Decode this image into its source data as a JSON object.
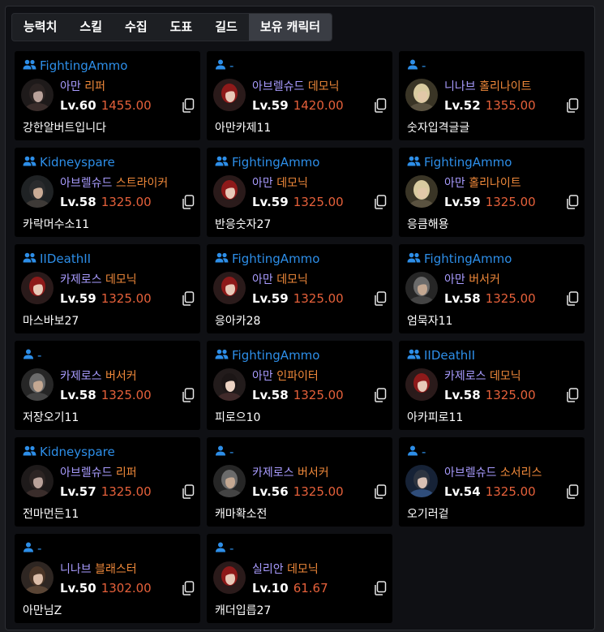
{
  "tabs": [
    "능력치",
    "스킬",
    "수집",
    "도표",
    "길드",
    "보유 캐릭터"
  ],
  "active_tab": 5,
  "colors": {
    "accent_user": "#2d8ee8",
    "server": "#a99cff",
    "class": "#f0893a",
    "item_level": "#e5603a"
  },
  "characters": [
    {
      "user_icon": "group-icon",
      "user": "FightingAmmo",
      "server": "아만",
      "cls": "리퍼",
      "level": "Lv.60",
      "ilvl": "1455.00",
      "name": "강한알버트입니다",
      "avatar": "dark-hooded"
    },
    {
      "user_icon": "person-icon",
      "user": "-",
      "server": "아브렐슈드",
      "cls": "데모닉",
      "level": "Lv.59",
      "ilvl": "1420.00",
      "name": "아만카제11",
      "avatar": "red-hair"
    },
    {
      "user_icon": "person-icon",
      "user": "-",
      "server": "니나브",
      "cls": "홀리나이트",
      "level": "Lv.52",
      "ilvl": "1355.00",
      "name": "숫자입격글글",
      "avatar": "blond"
    },
    {
      "user_icon": "group-icon",
      "user": "Kidneyspare",
      "server": "아브렐슈드",
      "cls": "스트라이커",
      "level": "Lv.58",
      "ilvl": "1325.00",
      "name": "카락머수소11",
      "avatar": "dark-male"
    },
    {
      "user_icon": "group-icon",
      "user": "FightingAmmo",
      "server": "아만",
      "cls": "데모닉",
      "level": "Lv.59",
      "ilvl": "1325.00",
      "name": "반응숫자27",
      "avatar": "red-hair"
    },
    {
      "user_icon": "group-icon",
      "user": "FightingAmmo",
      "server": "아만",
      "cls": "홀리나이트",
      "level": "Lv.59",
      "ilvl": "1325.00",
      "name": "응큼해용",
      "avatar": "blond"
    },
    {
      "user_icon": "group-icon",
      "user": "IIDeathII",
      "server": "카제로스",
      "cls": "데모닉",
      "level": "Lv.59",
      "ilvl": "1325.00",
      "name": "마스바보27",
      "avatar": "red-hair"
    },
    {
      "user_icon": "group-icon",
      "user": "FightingAmmo",
      "server": "아만",
      "cls": "데모닉",
      "level": "Lv.59",
      "ilvl": "1325.00",
      "name": "응아카28",
      "avatar": "red-hair"
    },
    {
      "user_icon": "group-icon",
      "user": "FightingAmmo",
      "server": "아만",
      "cls": "버서커",
      "level": "Lv.58",
      "ilvl": "1325.00",
      "name": "엄묵자11",
      "avatar": "grey-male"
    },
    {
      "user_icon": "person-icon",
      "user": "-",
      "server": "카제로스",
      "cls": "버서커",
      "level": "Lv.58",
      "ilvl": "1325.00",
      "name": "저장오기11",
      "avatar": "grey-male"
    },
    {
      "user_icon": "group-icon",
      "user": "FightingAmmo",
      "server": "아만",
      "cls": "인파이터",
      "level": "Lv.58",
      "ilvl": "1325.00",
      "name": "피로으10",
      "avatar": "female-dark"
    },
    {
      "user_icon": "group-icon",
      "user": "IIDeathII",
      "server": "카제로스",
      "cls": "데모닉",
      "level": "Lv.58",
      "ilvl": "1325.00",
      "name": "아카피로11",
      "avatar": "red-hair"
    },
    {
      "user_icon": "group-icon",
      "user": "Kidneyspare",
      "server": "아브렐슈드",
      "cls": "리퍼",
      "level": "Lv.57",
      "ilvl": "1325.00",
      "name": "전마먼든11",
      "avatar": "dark-hooded"
    },
    {
      "user_icon": "person-icon",
      "user": "-",
      "server": "카제로스",
      "cls": "버서커",
      "level": "Lv.56",
      "ilvl": "1325.00",
      "name": "캐마확소전",
      "avatar": "grey-male"
    },
    {
      "user_icon": "person-icon",
      "user": "-",
      "server": "아브렐슈드",
      "cls": "소서리스",
      "level": "Lv.54",
      "ilvl": "1325.00",
      "name": "오기러겉",
      "avatar": "blue-female"
    },
    {
      "user_icon": "person-icon",
      "user": "-",
      "server": "니나브",
      "cls": "블래스터",
      "level": "Lv.50",
      "ilvl": "1302.00",
      "name": "아만님Z",
      "avatar": "brown-female"
    },
    {
      "user_icon": "person-icon",
      "user": "-",
      "server": "실리안",
      "cls": "데모닉",
      "level": "Lv.10",
      "ilvl": "61.67",
      "name": "캐더입릅27",
      "avatar": "red-hair"
    }
  ]
}
